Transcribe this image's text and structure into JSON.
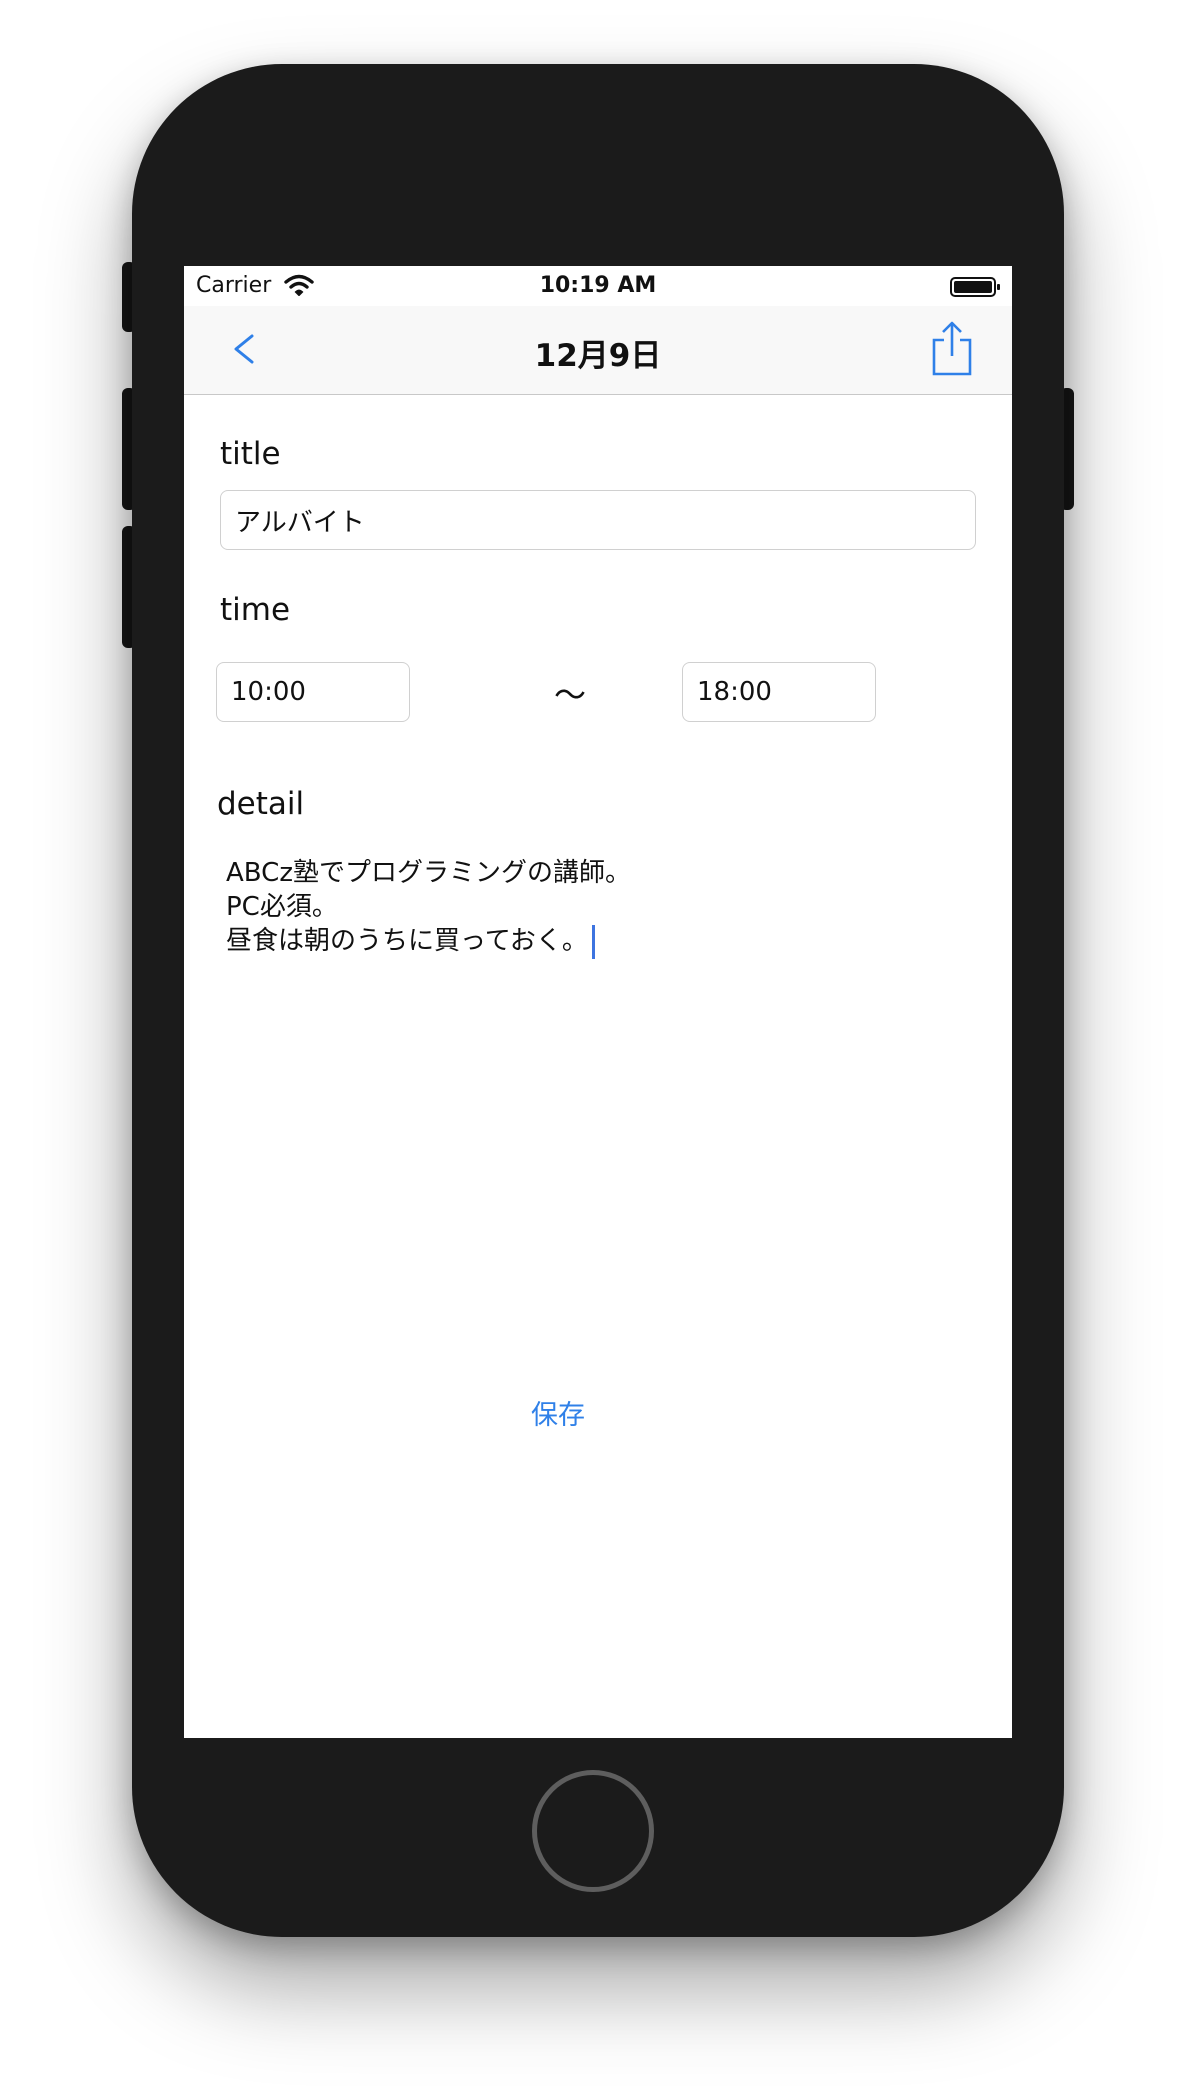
{
  "status_bar": {
    "carrier": "Carrier",
    "time": "10:19 AM",
    "wifi_icon": "wifi-icon",
    "battery_icon": "battery-icon"
  },
  "nav_bar": {
    "back_label": "<",
    "title": "12月9日",
    "share_icon": "share-icon"
  },
  "form": {
    "title_label": "title",
    "title_value": "アルバイト",
    "time_label": "time",
    "start_time": "10:00",
    "separator": "〜",
    "end_time": "18:00",
    "detail_label": "detail",
    "detail_lines": [
      "ABCz塾でプログラミングの講師。",
      "PC必須。",
      "昼食は朝のうちに買っておく。"
    ]
  },
  "actions": {
    "save_label": "保存"
  },
  "colors": {
    "accent": "#2f80e8",
    "device_body": "#1b1b1b",
    "nav_background": "#f8f8f8"
  }
}
